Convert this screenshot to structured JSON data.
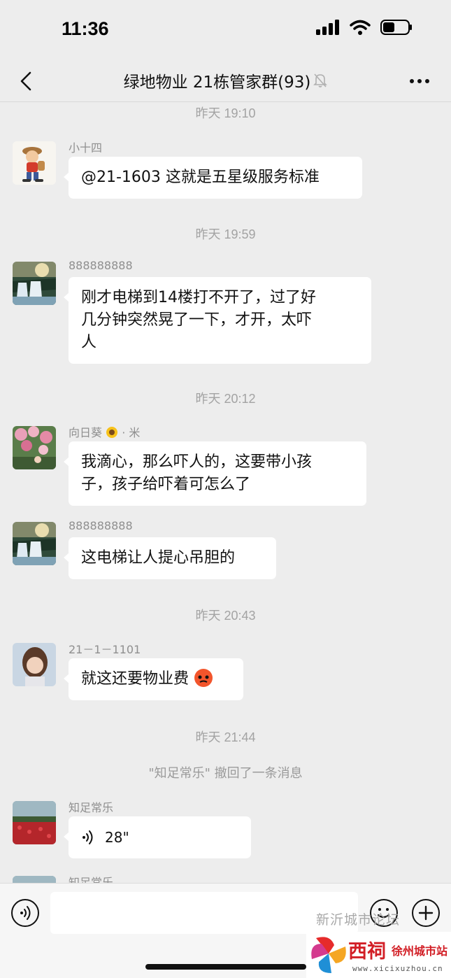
{
  "status": {
    "time": "11:36"
  },
  "header": {
    "title": "绿地物业 21栋管家群(93)"
  },
  "chat": {
    "timestamps": [
      "昨天 19:10",
      "昨天 19:59",
      "昨天 20:12",
      "昨天 20:43",
      "昨天 21:44"
    ],
    "system_message": "\"知足常乐\" 撤回了一条消息",
    "messages": [
      {
        "sender": "小十四",
        "text": "@21-1603 这就是五星级服务标准"
      },
      {
        "sender": "888888888",
        "lines": [
          "刚才电梯到14楼打不开了，过了好",
          "几分钟突然晃了一下，才开，太吓",
          "人"
        ]
      },
      {
        "sender": "向日葵",
        "sender_suffix": "· 米",
        "lines": [
          "我滴心，那么吓人的，这要带小孩",
          "子，孩子给吓着可怎么了"
        ]
      },
      {
        "sender": "888888888",
        "text": "这电梯让人提心吊胆的"
      },
      {
        "sender": "21－1－1101",
        "text": "就这还要物业费"
      },
      {
        "sender": "知足常乐",
        "voice_duration": "28\""
      },
      {
        "sender": "知足常乐"
      }
    ]
  },
  "watermark": {
    "forum_text": "新沂城市论坛",
    "logo_main": "西祠",
    "logo_city": "徐州城市站",
    "logo_url": "www.xicixuzhou.cn"
  },
  "colors": {
    "background": "#ededed",
    "bubble": "#ffffff",
    "timestamp": "#a3a3a3"
  }
}
